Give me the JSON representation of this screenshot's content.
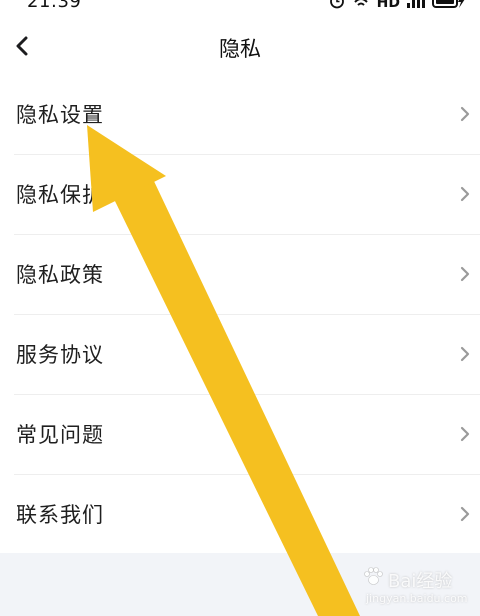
{
  "status_bar": {
    "time": "21:39",
    "network_label": "HD",
    "icons": [
      "alarm-icon",
      "wifi-icon",
      "signal-icon",
      "battery-charging-icon"
    ]
  },
  "nav": {
    "title": "隐私",
    "back_icon": "chevron-left-icon"
  },
  "menu": {
    "items": [
      {
        "label": "隐私设置"
      },
      {
        "label": "隐私保护"
      },
      {
        "label": "隐私政策"
      },
      {
        "label": "服务协议"
      },
      {
        "label": "常见问题"
      },
      {
        "label": "联系我们"
      }
    ]
  },
  "overlay": {
    "arrow_color": "#f5c020",
    "watermark": "Bai经验",
    "watermark_url": "jingyan.baidu.com"
  },
  "colors": {
    "background": "#f2f4f8",
    "panel": "#ffffff",
    "divider": "#eeeeee",
    "chevron": "#9a9a9a"
  }
}
